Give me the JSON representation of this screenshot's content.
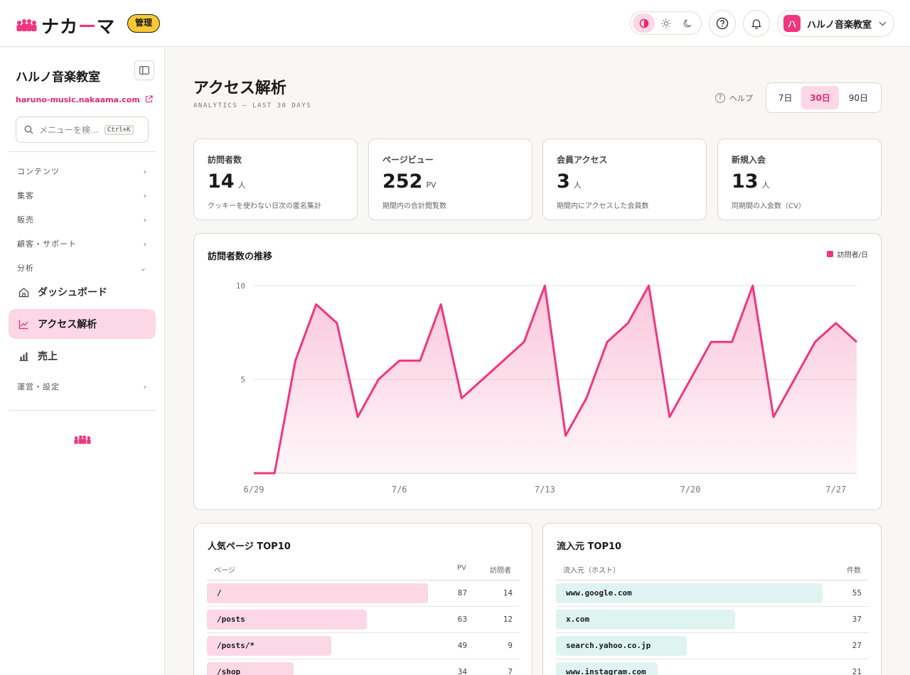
{
  "brand": {
    "logo_text_1": "ナカ",
    "logo_text_2": "ー",
    "logo_text_3": "マ",
    "admin_badge": "管理",
    "accent": "#f0367e"
  },
  "header": {
    "account_name": "ハルノ音楽教室",
    "avatar_letter": "ハ"
  },
  "sidebar": {
    "site_name": "ハルノ音楽教室",
    "site_url": "haruno-music.nakaama.com",
    "search_placeholder": "メニューを検…",
    "search_shortcut": "Ctrl+K",
    "groups": [
      "コンテンツ",
      "集客",
      "販売",
      "顧客・サポート",
      "分析",
      "運営・設定"
    ],
    "items": [
      "ダッシュボード",
      "アクセス解析",
      "売上"
    ]
  },
  "page": {
    "title": "アクセス解析",
    "subtitle": "ANALYTICS — LAST 30 DAYS",
    "help": "ヘルプ",
    "ranges": [
      "7日",
      "30日",
      "90日"
    ],
    "active_range": "30日"
  },
  "kpis": [
    {
      "label": "訪問者数",
      "value": "14",
      "unit": "人",
      "note": "クッキーを使わない日次の匿名集計"
    },
    {
      "label": "ページビュー",
      "value": "252",
      "unit": "PV",
      "note": "期間内の合計閲覧数"
    },
    {
      "label": "会員アクセス",
      "value": "3",
      "unit": "人",
      "note": "期間内にアクセスした会員数"
    },
    {
      "label": "新規入会",
      "value": "13",
      "unit": "人",
      "note": "同期間の入会数（CV）"
    }
  ],
  "chart_data": {
    "type": "area",
    "title": "訪問者数の推移",
    "series": [
      {
        "name": "訪問者/日",
        "values": [
          0,
          0,
          6,
          9,
          8,
          3,
          5,
          6,
          6,
          9,
          4,
          5,
          6,
          7,
          10,
          2,
          4,
          7,
          8,
          10,
          3,
          5,
          7,
          7,
          10,
          3,
          5,
          7,
          8,
          7
        ]
      }
    ],
    "x_tick_labels": [
      "6/29",
      "7/6",
      "7/13",
      "7/20",
      "7/27"
    ],
    "x_tick_index": [
      0,
      7,
      14,
      21,
      28
    ],
    "y_ticks": [
      5,
      10
    ],
    "ylim": [
      0,
      10
    ],
    "grid": true,
    "legend": "top-right",
    "color": "#f0367e"
  },
  "pages_table": {
    "title": "人気ページ TOP10",
    "headers": [
      "ページ",
      "PV",
      "訪問者"
    ],
    "rows": [
      {
        "page": "/",
        "pv": "87",
        "visitors": "14",
        "pv_value": 87
      },
      {
        "page": "/posts",
        "pv": "63",
        "visitors": "12",
        "pv_value": 63
      },
      {
        "page": "/posts/*",
        "pv": "49",
        "visitors": "9",
        "pv_value": 49
      },
      {
        "page": "/shop",
        "pv": "34",
        "visitors": "7",
        "pv_value": 34
      }
    ]
  },
  "sources_table": {
    "title": "流入元 TOP10",
    "headers": [
      "流入元（ホスト）",
      "件数"
    ],
    "rows": [
      {
        "host": "www.google.com",
        "count": "55",
        "count_value": 55
      },
      {
        "host": "x.com",
        "count": "37",
        "count_value": 37
      },
      {
        "host": "search.yahoo.co.jp",
        "count": "27",
        "count_value": 27
      },
      {
        "host": "www.instagram.com",
        "count": "21",
        "count_value": 21
      }
    ]
  }
}
